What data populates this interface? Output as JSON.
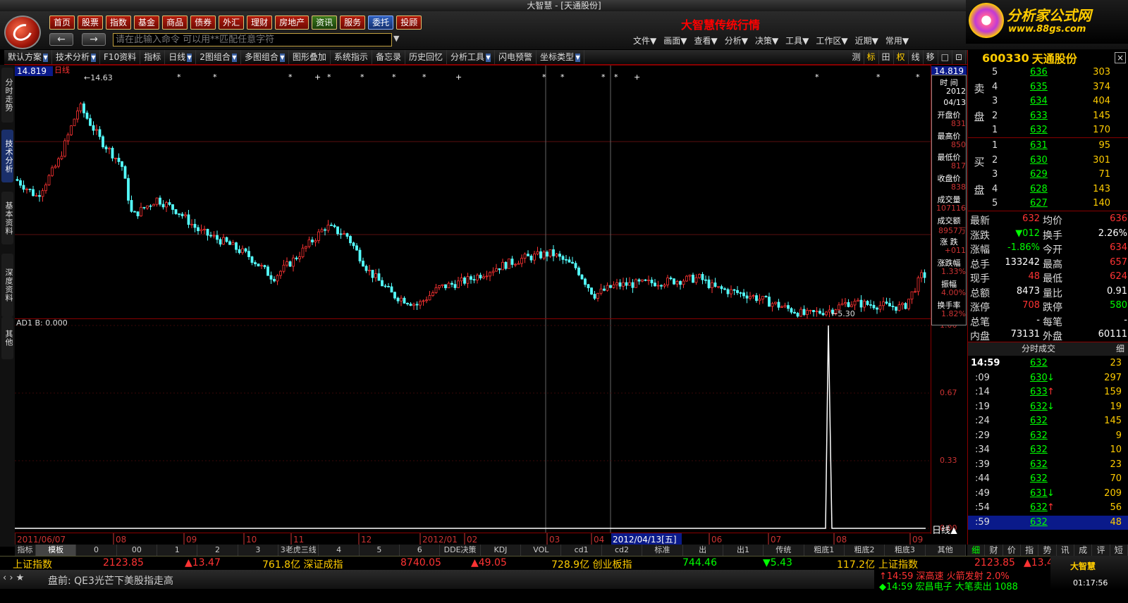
{
  "window": {
    "title": "大智慧 - [天通股份]",
    "controls": "− □ ×"
  },
  "header": {
    "nav": [
      "首页",
      "股票",
      "指数",
      "基金",
      "商品",
      "债券",
      "外汇",
      "理财",
      "房地产",
      "资讯",
      "服务",
      "委托",
      "投顾"
    ],
    "active_nav": "委托",
    "back": "←",
    "forward": "→",
    "command_placeholder": "请在此输入命令    可以用**匹配任意字符",
    "brand_title": "大智慧传统行情",
    "menus": [
      "文件▼",
      "画面▼",
      "查看▼",
      "分析▼",
      "决策▼",
      "工具▼",
      "工作区▼",
      "近期▼",
      "常用▼"
    ],
    "site_name": "分析家公式网",
    "site_url": "www.88gs.com"
  },
  "toolbar": {
    "items": [
      {
        "label": "默认方案",
        "dd": true
      },
      {
        "label": "技术分析",
        "dd": true
      },
      {
        "label": "F10资料",
        "dd": false
      },
      {
        "label": "指标",
        "dd": false
      },
      {
        "label": "日线",
        "dd": true
      },
      {
        "label": "2图组合",
        "dd": true
      },
      {
        "label": "多图组合",
        "dd": true
      },
      {
        "label": "图形叠加",
        "dd": false
      },
      {
        "label": "系统指示",
        "dd": false
      },
      {
        "label": "备忘录",
        "dd": false
      },
      {
        "label": "历史回忆",
        "dd": false
      },
      {
        "label": "分析工具",
        "dd": true
      },
      {
        "label": "闪电预警",
        "dd": false
      },
      {
        "label": "坐标类型",
        "dd": true
      }
    ],
    "right": [
      "测",
      "标",
      "田",
      "权",
      "线",
      "移",
      "□",
      "⊡"
    ]
  },
  "side_tabs": [
    "分时走势",
    "技术分析",
    "基本资料",
    "深度资料",
    "其他"
  ],
  "chart": {
    "period_label": "日线",
    "price_box": "14.819",
    "high_label": "14.63",
    "low_label": "5.30",
    "indicator_label": "AD1  B: 0.000",
    "sub_axis": [
      "1.00",
      "0.67",
      "0.33",
      "0.00"
    ],
    "sub_axis_footer": "日线▲",
    "date_labels": [
      "2011/06/07",
      "08",
      "09",
      "10",
      "11",
      "12",
      "2012/01",
      "02",
      "03",
      "04",
      "2012/04/13[五]",
      "06",
      "07",
      "08",
      "09"
    ]
  },
  "chart_data": {
    "type": "candlestick",
    "title": "",
    "price_range": [
      5.3,
      14.819
    ],
    "series_summary": {
      "high": 14.63,
      "low": 5.3
    },
    "indicator": {
      "name": "AD1",
      "B": 0.0,
      "ylim": [
        0.0,
        1.0
      ],
      "spike_at": "08"
    },
    "x_labels": [
      "2011/06/07",
      "08",
      "09",
      "10",
      "11",
      "12",
      "2012/01",
      "02",
      "03",
      "04",
      "2012/04/13[五]",
      "06",
      "07",
      "08",
      "09"
    ]
  },
  "info_panel": [
    {
      "label": "时 间",
      "value": "2012"
    },
    {
      "label": "",
      "value": "04/13"
    },
    {
      "label": "开盘价",
      "value": "831"
    },
    {
      "label": "最高价",
      "value": "850"
    },
    {
      "label": "最低价",
      "value": "817"
    },
    {
      "label": "收盘价",
      "value": "838"
    },
    {
      "label": "成交量",
      "value": "107116"
    },
    {
      "label": "成交额",
      "value": "8957万"
    },
    {
      "label": "涨 跌",
      "value": "+011"
    },
    {
      "label": "涨跌幅",
      "value": "1.33%"
    },
    {
      "label": "振幅",
      "value": "4.00%"
    },
    {
      "label": "换手率",
      "value": "1.82%"
    }
  ],
  "stock": {
    "code": "600330",
    "name": "天通股份"
  },
  "orderbook": {
    "sell_label": [
      "卖",
      "盘"
    ],
    "buy_label": [
      "买",
      "盘"
    ],
    "sell": [
      {
        "lvl": "5",
        "price": "636",
        "vol": "303"
      },
      {
        "lvl": "4",
        "price": "635",
        "vol": "374"
      },
      {
        "lvl": "3",
        "price": "634",
        "vol": "404"
      },
      {
        "lvl": "2",
        "price": "633",
        "vol": "145"
      },
      {
        "lvl": "1",
        "price": "632",
        "vol": "170"
      }
    ],
    "buy": [
      {
        "lvl": "1",
        "price": "631",
        "vol": "95"
      },
      {
        "lvl": "2",
        "price": "630",
        "vol": "301"
      },
      {
        "lvl": "3",
        "price": "629",
        "vol": "71"
      },
      {
        "lvl": "4",
        "price": "628",
        "vol": "143"
      },
      {
        "lvl": "5",
        "price": "627",
        "vol": "140"
      }
    ]
  },
  "quote": [
    {
      "l1": "最新",
      "v1": "632",
      "l2": "均价",
      "v2": "636",
      "c1": "#f33",
      "c2": "#f33"
    },
    {
      "l1": "涨跌",
      "v1": "▼012",
      "l2": "换手",
      "v2": "2.26%",
      "c1": "#0f0",
      "c2": "#fff"
    },
    {
      "l1": "涨幅",
      "v1": "-1.86%",
      "l2": "今开",
      "v2": "634",
      "c1": "#0f0",
      "c2": "#f33"
    },
    {
      "l1": "总手",
      "v1": "133242",
      "l2": "最高",
      "v2": "657",
      "c1": "#fff",
      "c2": "#f33"
    },
    {
      "l1": "现手",
      "v1": "48",
      "l2": "最低",
      "v2": "624",
      "c1": "#f33",
      "c2": "#f33"
    },
    {
      "l1": "总额",
      "v1": "8473",
      "l2": "量比",
      "v2": "0.91",
      "c1": "#fff",
      "c2": "#fff"
    },
    {
      "l1": "涨停",
      "v1": "708",
      "l2": "跌停",
      "v2": "580",
      "c1": "#f33",
      "c2": "#0f0"
    },
    {
      "l1": "总笔",
      "v1": "-",
      "l2": "每笔",
      "v2": "-",
      "c1": "#fff",
      "c2": "#fff"
    },
    {
      "l1": "内盘",
      "v1": "73131",
      "l2": "外盘",
      "v2": "60111",
      "c1": "#fff",
      "c2": "#fff"
    }
  ],
  "trades": {
    "header": "分时成交",
    "header_right": "细",
    "rows": [
      {
        "t": "14:59",
        "p": "632",
        "a": "",
        "v": "23"
      },
      {
        "t": ":09",
        "p": "630",
        "a": "↓",
        "v": "297"
      },
      {
        "t": ":14",
        "p": "633",
        "a": "↑",
        "v": "159"
      },
      {
        "t": ":19",
        "p": "632",
        "a": "↓",
        "v": "19"
      },
      {
        "t": ":24",
        "p": "632",
        "a": "",
        "v": "145"
      },
      {
        "t": ":29",
        "p": "632",
        "a": "",
        "v": "9"
      },
      {
        "t": ":34",
        "p": "632",
        "a": "",
        "v": "10"
      },
      {
        "t": ":39",
        "p": "632",
        "a": "",
        "v": "23"
      },
      {
        "t": ":44",
        "p": "632",
        "a": "",
        "v": "70"
      },
      {
        "t": ":49",
        "p": "631",
        "a": "↓",
        "v": "209"
      },
      {
        "t": ":54",
        "p": "632",
        "a": "↑",
        "v": "56"
      },
      {
        "t": ":59",
        "p": "632",
        "a": "",
        "v": "48"
      }
    ]
  },
  "bottom_tabs": [
    "指标",
    "模板",
    "0",
    "00",
    "1",
    "2",
    "3",
    "3老虎三线",
    "4",
    "5",
    "6",
    "DDE决策",
    "KDJ",
    "VOL",
    "cd1",
    "cd2",
    "标准",
    "出",
    "出1",
    "传统",
    "粗底1",
    "粗底2",
    "粗底3",
    "其他"
  ],
  "right_tabs": [
    "细",
    "财",
    "价",
    "指",
    "势",
    "讯",
    "成",
    "评",
    "短"
  ],
  "ticker": [
    {
      "text": "上证指数",
      "color": "#ffcc00"
    },
    {
      "text": "2123.85",
      "color": "#f33"
    },
    {
      "text": "▲13.47",
      "color": "#f33"
    },
    {
      "text": "761.8亿 深证成指",
      "color": "#ffcc00"
    },
    {
      "text": "8740.05",
      "color": "#f33"
    },
    {
      "text": "▲49.05",
      "color": "#f33"
    },
    {
      "text": "728.9亿 创业板指",
      "color": "#ffcc00"
    },
    {
      "text": "744.46",
      "color": "#0f0"
    },
    {
      "text": "▼5.43",
      "color": "#0f0"
    },
    {
      "text": "117.2亿",
      "color": "#ffcc00"
    },
    {
      "text": "上证指数",
      "color": "#ffcc00"
    },
    {
      "text": "2123.85",
      "color": "#f33"
    },
    {
      "text": "▲13.47",
      "color": "#f33"
    }
  ],
  "news": "盘前: QE3光芒下美股指走高",
  "alerts": [
    {
      "text": "↑14:59 深高速  火箭发射 2.0%",
      "color": "#f33"
    },
    {
      "text": "◆14:59 宏昌电子 大笔卖出 1088",
      "color": "#0f0"
    }
  ],
  "clock": "01:17:56",
  "brand_small": "大智慧"
}
